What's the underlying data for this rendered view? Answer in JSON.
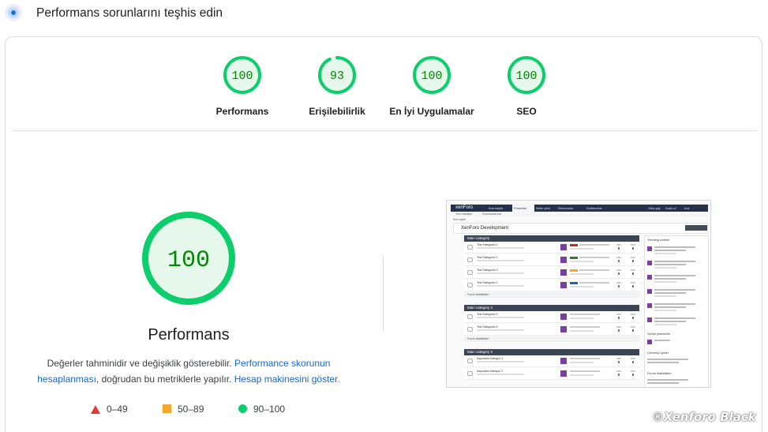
{
  "header": {
    "title": "Performans sorunlarını teşhis edin",
    "icon": "lighthouse-icon"
  },
  "colors": {
    "pass": "#0cce6b",
    "pass_fill": "#e6f7ec",
    "pass_text": "#008800",
    "average": "#f4a72b",
    "fail": "#e53935",
    "link": "#1967d2"
  },
  "categories": [
    {
      "label": "Performans",
      "score": "100",
      "value": 1.0
    },
    {
      "label": "Erişilebilirlik",
      "score": "93",
      "value": 0.93
    },
    {
      "label": "En İyi Uygulamalar",
      "score": "100",
      "value": 1.0
    },
    {
      "label": "SEO",
      "score": "100",
      "value": 1.0
    }
  ],
  "main": {
    "score": "100",
    "score_value": 1.0,
    "title": "Performans",
    "desc_prefix": "Değerler tahminidir ve değişiklik gösterebilir.",
    "desc_link1": "Performance skorunun hesaplanması",
    "desc_middle": ", doğrudan bu metriklerle yapılır.",
    "desc_link2": "Hesap makinesini göster."
  },
  "legend": [
    {
      "shape": "triangle",
      "range": "0–49"
    },
    {
      "shape": "square",
      "range": "50–89"
    },
    {
      "shape": "circle",
      "range": "90–100"
    }
  ],
  "thumbnail": {
    "logo": "xenForo",
    "nav": [
      "Ana sayfa",
      "Forumlar",
      "Neler yeni",
      "Resources",
      "Kullanıcılar"
    ],
    "nav_right": [
      "Giriş yap",
      "Kayıt ol",
      "Ara"
    ],
    "sub_nav": [
      "Yeni mesajlar",
      "Forumlarda ara"
    ],
    "breadcrumb": "Ana sayfa",
    "page_title": "XenForo Development",
    "sections": [
      {
        "name": "Main category",
        "rows": [
          "Test Kategorisi 1",
          "Test Kategorisi 2",
          "Test Kategorisi 3",
          "Test Kategorisi 4"
        ],
        "footer": "Forum istatistikleri"
      },
      {
        "name": "Main category 2",
        "rows": [
          "Test Kategorisi 5",
          "Test Kategorisi 6"
        ],
        "footer": "Forum istatistikleri"
      },
      {
        "name": "Main category 3",
        "rows": [
          "Kaynaklar Kategori 1",
          "Kaynaklar Kategori 2"
        ]
      }
    ],
    "sidebar": [
      "Trending content",
      "Online yöneticiler",
      "Çevrimiçi üyeler",
      "Forum istatistikleri"
    ]
  },
  "watermark": "®Xenforo Black"
}
